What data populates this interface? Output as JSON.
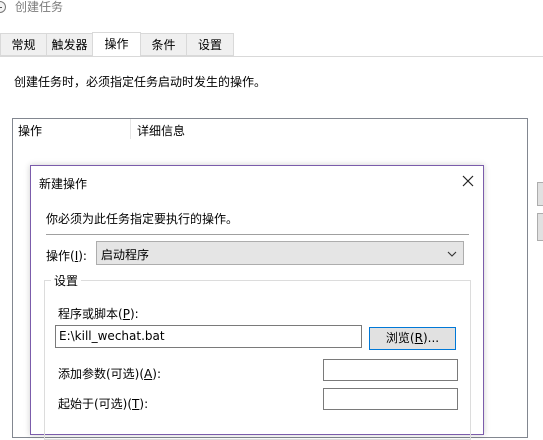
{
  "window": {
    "title": "创建任务"
  },
  "tabs": [
    {
      "label": "常规"
    },
    {
      "label": "触发器"
    },
    {
      "label": "操作"
    },
    {
      "label": "条件"
    },
    {
      "label": "设置"
    }
  ],
  "actions_page": {
    "description": "创建任务时，必须指定任务启动时发生的操作。",
    "columns": [
      "操作",
      "详细信息"
    ]
  },
  "dialog": {
    "title": "新建操作",
    "description": "你必须为此任务指定要执行的操作。",
    "action_label": "操作(",
    "action_label_key": "I",
    "action_label_end": "):",
    "action_value": "启动程序",
    "settings_label": "设置",
    "program_label": "程序或脚本(",
    "program_label_key": "P",
    "program_label_end": "):",
    "program_value": "E:\\kill_wechat.bat",
    "browse_label": "浏览(",
    "browse_key": "R",
    "browse_end": ")...",
    "args_label": "添加参数(可选)(",
    "args_key": "A",
    "args_end": "):",
    "args_value": "",
    "start_label": "起始于(可选)(",
    "start_key": "T",
    "start_end": "):",
    "start_value": ""
  },
  "icons": {
    "app": "clock-task-icon",
    "close": "close-icon",
    "dropdown": "chevron-down-icon"
  },
  "colors": {
    "dialog_border": "#7b5cab",
    "focus_border": "#0078d7"
  }
}
